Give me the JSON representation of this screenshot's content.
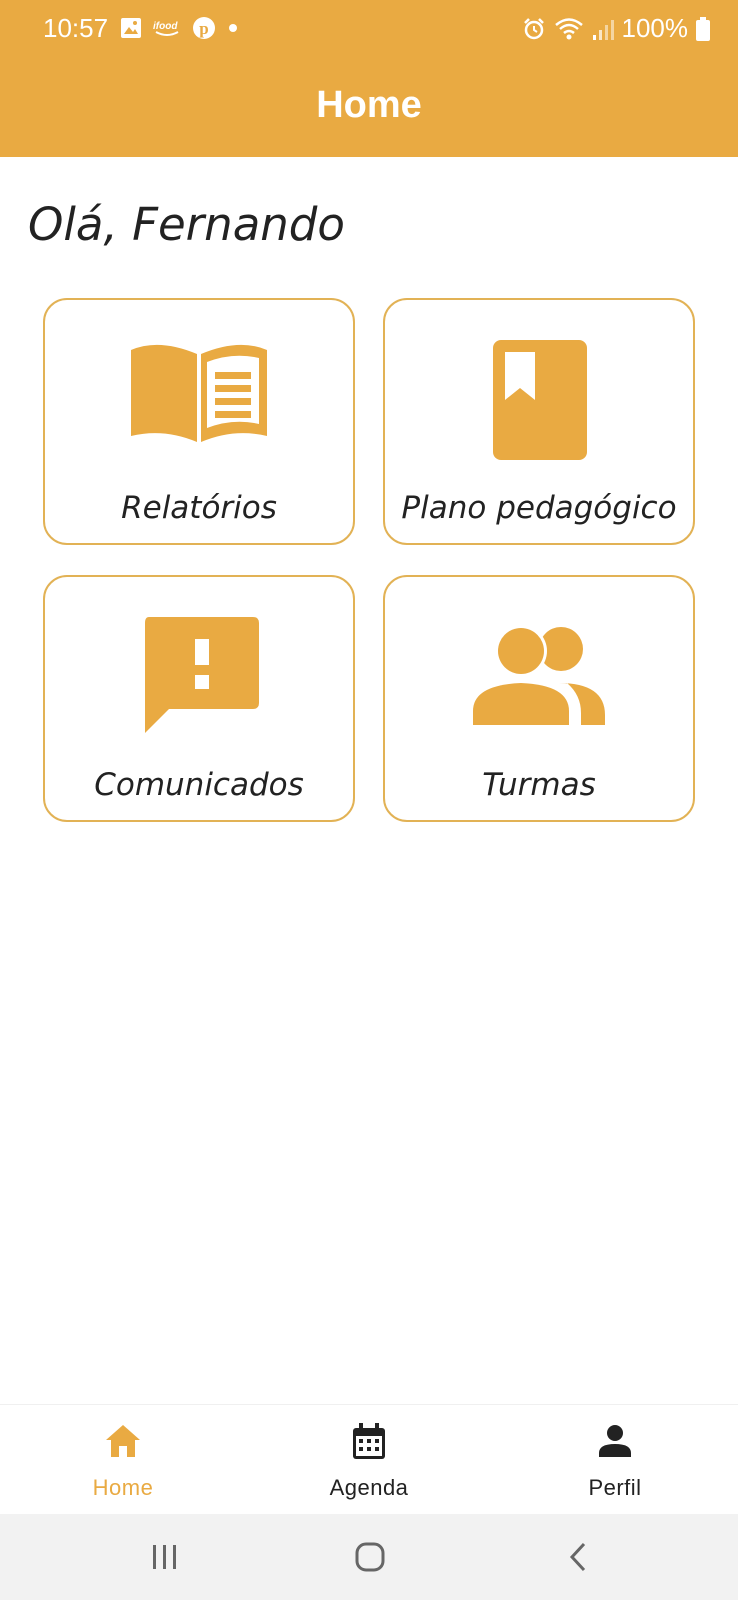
{
  "status_bar": {
    "time": "10:57",
    "battery": "100%",
    "left_icons": [
      "image-icon",
      "ifood-icon",
      "pinterest-icon",
      "dot-icon"
    ],
    "right_icons": [
      "alarm-icon",
      "wifi-icon",
      "signal-icon",
      "battery-icon"
    ]
  },
  "header": {
    "title": "Home"
  },
  "greeting": "Olá, Fernando",
  "cards": [
    {
      "label": "Relatórios",
      "icon": "open-book-icon"
    },
    {
      "label": "Plano pedagógico",
      "icon": "bookmark-book-icon"
    },
    {
      "label": "Comunicados",
      "icon": "announcement-icon"
    },
    {
      "label": "Turmas",
      "icon": "group-icon"
    }
  ],
  "bottom_nav": [
    {
      "label": "Home",
      "icon": "home-icon",
      "active": true
    },
    {
      "label": "Agenda",
      "icon": "calendar-icon",
      "active": false
    },
    {
      "label": "Perfil",
      "icon": "person-icon",
      "active": false
    }
  ],
  "colors": {
    "primary": "#E9AA42",
    "card_border": "#E2B255",
    "text": "#222222",
    "nav_inactive": "#222222"
  }
}
